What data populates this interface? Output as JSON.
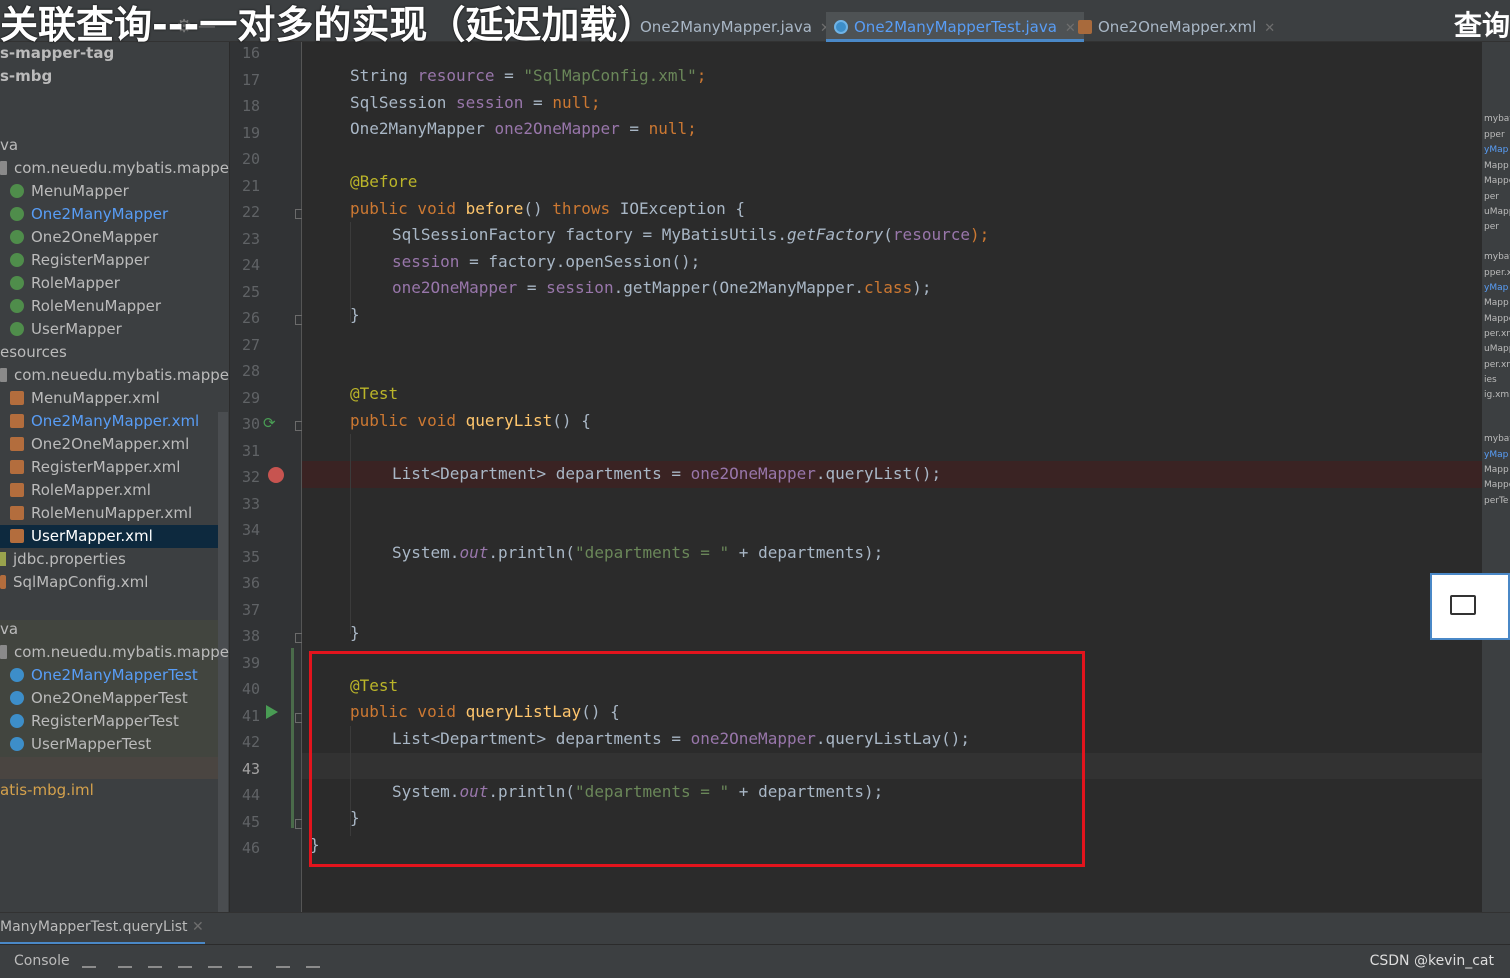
{
  "overlay": {
    "title": "关联查询---一对多的实现（延迟加载）",
    "title_right": "查询"
  },
  "tabs": [
    {
      "label": "One2ManyMapper.java",
      "active": false
    },
    {
      "label": "One2ManyMapperTest.java",
      "active": true
    },
    {
      "label": "One2OneMapper.xml",
      "active": false
    }
  ],
  "sidebar": {
    "items": [
      {
        "label": "s-mapper-tag"
      },
      {
        "label": "s-mbg"
      },
      {
        "label": "va"
      },
      {
        "label": "com.neuedu.mybatis.mapper"
      },
      {
        "label": "MenuMapper"
      },
      {
        "label": "One2ManyMapper"
      },
      {
        "label": "One2OneMapper"
      },
      {
        "label": "RegisterMapper"
      },
      {
        "label": "RoleMapper"
      },
      {
        "label": "RoleMenuMapper"
      },
      {
        "label": "UserMapper"
      },
      {
        "label": "esources"
      },
      {
        "label": "com.neuedu.mybatis.mapper"
      },
      {
        "label": "MenuMapper.xml"
      },
      {
        "label": "One2ManyMapper.xml"
      },
      {
        "label": "One2OneMapper.xml"
      },
      {
        "label": "RegisterMapper.xml"
      },
      {
        "label": "RoleMapper.xml"
      },
      {
        "label": "RoleMenuMapper.xml"
      },
      {
        "label": "UserMapper.xml"
      },
      {
        "label": "jdbc.properties"
      },
      {
        "label": "SqlMapConfig.xml"
      },
      {
        "label": "va"
      },
      {
        "label": "com.neuedu.mybatis.mapper"
      },
      {
        "label": "One2ManyMapperTest"
      },
      {
        "label": "One2OneMapperTest"
      },
      {
        "label": "RegisterMapperTest"
      },
      {
        "label": "UserMapperTest"
      },
      {
        "label": "atis-mbg.iml"
      }
    ]
  },
  "editor": {
    "line_numbers": [
      "16",
      "17",
      "18",
      "19",
      "20",
      "21",
      "22",
      "23",
      "24",
      "25",
      "26",
      "27",
      "28",
      "29",
      "30",
      "31",
      "32",
      "33",
      "34",
      "35",
      "36",
      "37",
      "38",
      "39",
      "40",
      "41",
      "42",
      "43",
      "44",
      "45",
      "46"
    ],
    "code": {
      "l17_type": "String ",
      "l17_var": "resource",
      "l17_eq": " = ",
      "l17_str": "\"SqlMapConfig.xml\"",
      "l17_end": ";",
      "l18_type": "SqlSession ",
      "l18_var": "session",
      "l18_eq": " = ",
      "l18_null": "null",
      "l18_end": ";",
      "l19_type": "One2ManyMapper ",
      "l19_var": "one2OneMapper",
      "l19_eq": " = ",
      "l19_null": "null",
      "l19_end": ";",
      "l21_ann": "@Before",
      "l22_kw": "public void ",
      "l22_name": "before",
      "l22_p": "() ",
      "l22_throws": "throws ",
      "l22_rest": "IOException {",
      "l23_a": "SqlSessionFactory factory = MyBatisUtils.",
      "l23_m": "getFactory",
      "l23_b": "(",
      "l23_f": "resource",
      "l23_c": ");",
      "l24_f": "session",
      "l24_rest": " = factory.openSession();",
      "l25_f": "one2OneMapper",
      "l25_eq": " = ",
      "l25_f2": "session",
      "l25_rest": ".getMapper(One2ManyMapper.",
      "l25_cls": "class",
      "l25_end": ");",
      "l26": "}",
      "l29_ann": "@Test",
      "l30_kw": "public void ",
      "l30_name": "queryList",
      "l30_rest": "() {",
      "l32_a": "List<Department> departments = ",
      "l32_f": "one2OneMapper",
      "l32_b": ".queryList();",
      "l35_a": "System.",
      "l35_out": "out",
      "l35_b": ".println(",
      "l35_str": "\"departments = \"",
      "l35_c": " + departments);",
      "l38": "}",
      "l40_ann": "@Test",
      "l41_kw": "public void ",
      "l41_name": "queryListLay",
      "l41_rest": "() {",
      "l42_a": "List<Department> departments = ",
      "l42_f": "one2OneMapper",
      "l42_b": ".queryListLay();",
      "l44_a": "System.",
      "l44_out": "out",
      "l44_b": ".println(",
      "l44_str": "\"departments = \"",
      "l44_c": " + departments);",
      "l45": "}",
      "l46": "}"
    }
  },
  "right_strip": [
    "mybat",
    "pper",
    "yMap",
    "Mapp",
    "Mappe",
    "per",
    "uMapp",
    "per",
    "mybat",
    "pper.x",
    "yMap",
    "Mapp",
    "Mappe",
    "per.xn",
    "uMapp",
    "per.xn",
    "ies",
    "ig.xml",
    "mybat",
    "yMap",
    "Mapp",
    "Mappe",
    "perTe"
  ],
  "run_panel": {
    "tab_label": "ManyMapperTest.queryList",
    "console_label": "Console"
  },
  "watermark": "CSDN @kevin_cat",
  "colors": {
    "keyword": "#cc7832",
    "string": "#6a8759",
    "annotation": "#bbb529",
    "field": "#9876aa",
    "method": "#ffc66d",
    "highlight_box": "#e3141d",
    "breakpoint": "#c75450"
  }
}
